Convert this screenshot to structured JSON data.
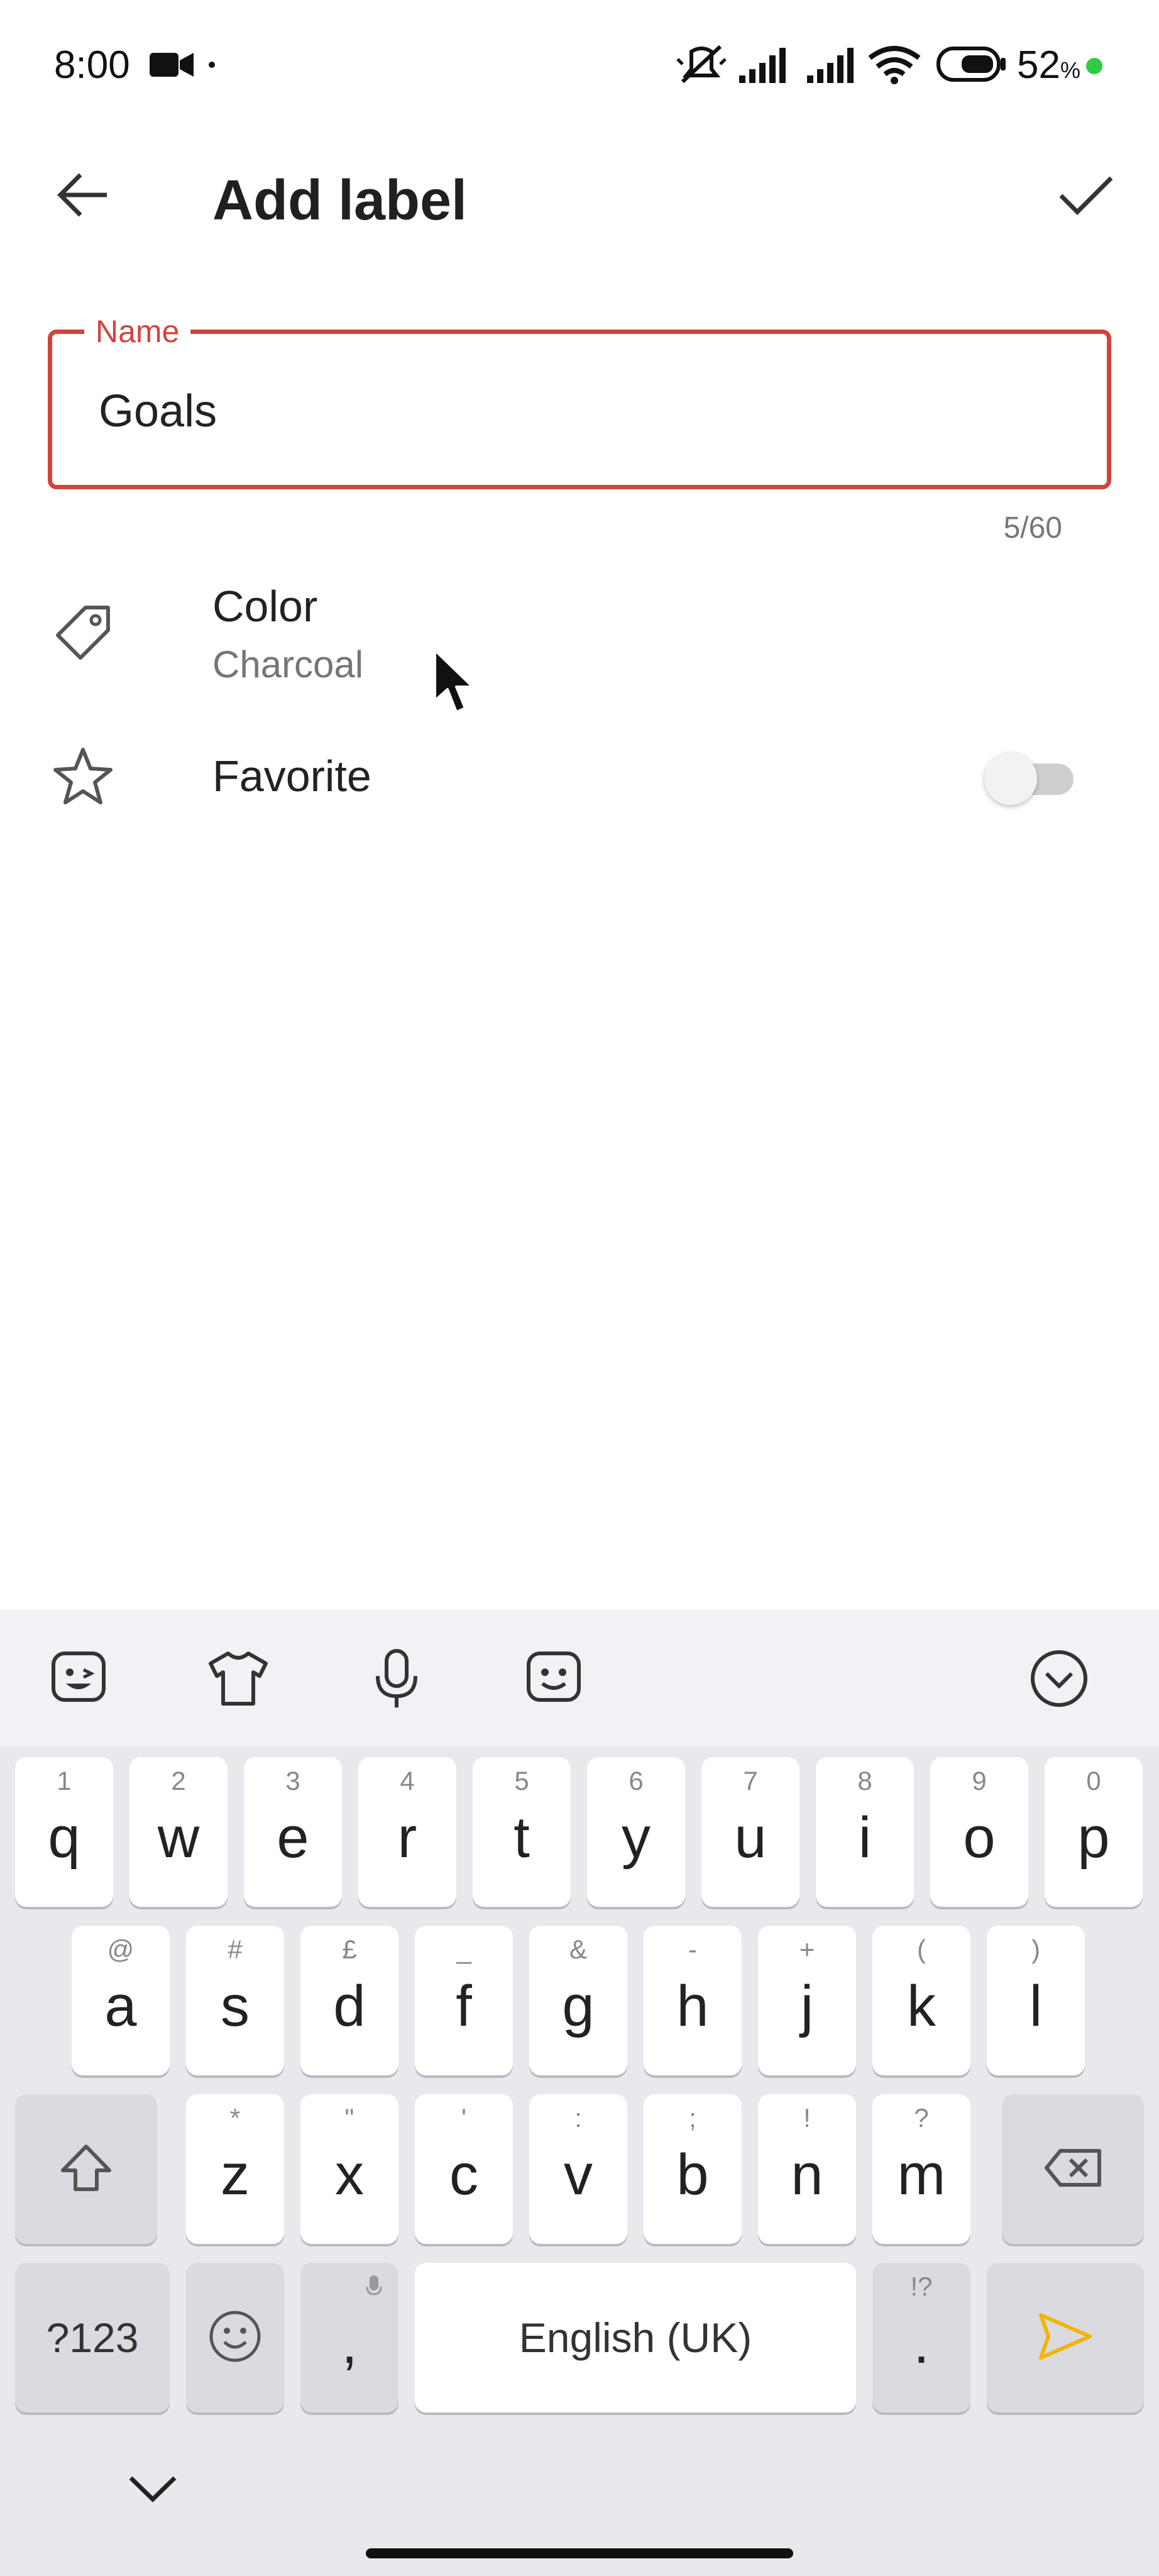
{
  "status_bar": {
    "time": "8:00",
    "battery": "52",
    "battery_unit": "%",
    "icons": [
      "video-camera-icon",
      "silent-icon",
      "signal-icon",
      "signal-icon",
      "wifi-icon",
      "battery-icon"
    ]
  },
  "app_bar": {
    "title": "Add label",
    "back_icon": "arrow-left-icon",
    "confirm_icon": "check-icon"
  },
  "name_field": {
    "label": "Name",
    "value": "Goals",
    "counter": "5/60",
    "accent_color": "#d1453b"
  },
  "color_row": {
    "title": "Color",
    "value": "Charcoal",
    "icon": "tag-icon"
  },
  "favorite_row": {
    "title": "Favorite",
    "icon": "star-icon",
    "enabled": false
  },
  "keyboard": {
    "toolbar_icons": [
      "sticker-icon",
      "theme-shirt-icon",
      "microphone-icon",
      "emoji-icon",
      "collapse-keyboard-icon"
    ],
    "row1": [
      {
        "key": "q",
        "hint": "1"
      },
      {
        "key": "w",
        "hint": "2"
      },
      {
        "key": "e",
        "hint": "3"
      },
      {
        "key": "r",
        "hint": "4"
      },
      {
        "key": "t",
        "hint": "5"
      },
      {
        "key": "y",
        "hint": "6"
      },
      {
        "key": "u",
        "hint": "7"
      },
      {
        "key": "i",
        "hint": "8"
      },
      {
        "key": "o",
        "hint": "9"
      },
      {
        "key": "p",
        "hint": "0"
      }
    ],
    "row2": [
      {
        "key": "a",
        "hint": "@"
      },
      {
        "key": "s",
        "hint": "#"
      },
      {
        "key": "d",
        "hint": "£"
      },
      {
        "key": "f",
        "hint": "_"
      },
      {
        "key": "g",
        "hint": "&"
      },
      {
        "key": "h",
        "hint": "-"
      },
      {
        "key": "j",
        "hint": "+"
      },
      {
        "key": "k",
        "hint": "("
      },
      {
        "key": "l",
        "hint": ")"
      }
    ],
    "row3": [
      {
        "key": "z",
        "hint": "*"
      },
      {
        "key": "x",
        "hint": "\""
      },
      {
        "key": "c",
        "hint": "'"
      },
      {
        "key": "v",
        "hint": ":"
      },
      {
        "key": "b",
        "hint": ";"
      },
      {
        "key": "n",
        "hint": "!"
      },
      {
        "key": "m",
        "hint": "?"
      }
    ],
    "symbols_label": "?123",
    "comma": ",",
    "space_label": "English (UK)",
    "period": ".",
    "period_hint": "!?",
    "send_color": "#f4b400"
  }
}
